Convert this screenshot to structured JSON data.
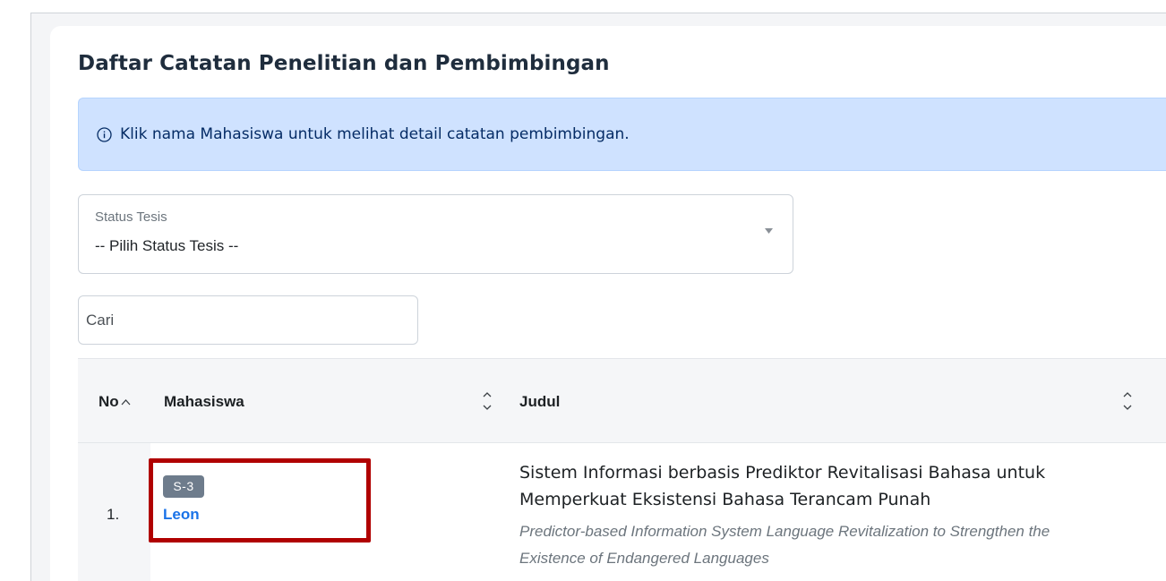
{
  "page": {
    "title": "Daftar Catatan Penelitian dan Pembimbingan"
  },
  "alert": {
    "text": "Klik nama Mahasiswa untuk melihat detail catatan pembimbingan.",
    "icon": "info-circle-icon"
  },
  "filter": {
    "label": "Status Tesis",
    "value": "-- Pilih Status Tesis --"
  },
  "search": {
    "placeholder": "Cari"
  },
  "table": {
    "headers": {
      "no": "No",
      "mahasiswa": "Mahasiswa",
      "judul": "Judul"
    },
    "rows": [
      {
        "no": "1.",
        "badge": "S-3",
        "name": "Leon",
        "title_id": "Sistem Informasi berbasis Prediktor Revitalisasi Bahasa untuk Memperkuat Eksistensi Bahasa Terancam Punah",
        "title_en": "Predictor-based Information System Language Revitalization to Strengthen the Existence of Endangered Languages"
      }
    ]
  },
  "colors": {
    "highlight_box": "#b00000",
    "link": "#1a73e8",
    "alert_bg": "#cfe2ff",
    "badge_bg": "#6e7c8c"
  }
}
